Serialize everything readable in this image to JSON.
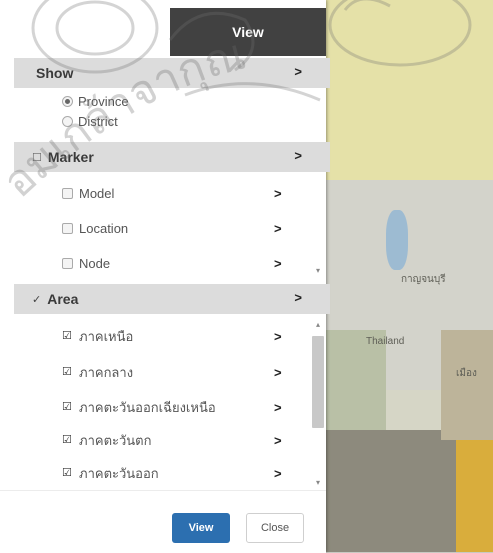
{
  "tabs": {
    "left_label": "",
    "right_label": "View"
  },
  "show": {
    "title": "Show",
    "options": [
      {
        "label": "Province",
        "selected": true
      },
      {
        "label": "District",
        "selected": false
      }
    ]
  },
  "marker": {
    "title": "Marker",
    "items": [
      {
        "label": "Model"
      },
      {
        "label": "Location"
      },
      {
        "label": "Node"
      }
    ]
  },
  "area": {
    "title": "Area",
    "items": [
      {
        "label": "ภาคเหนือ"
      },
      {
        "label": "ภาคกลาง"
      },
      {
        "label": "ภาคตะวันออกเฉียงเหนือ"
      },
      {
        "label": "ภาคตะวันตก"
      },
      {
        "label": "ภาคตะวันออก"
      }
    ]
  },
  "footer": {
    "view_label": "View",
    "close_label": "Close"
  },
  "map": {
    "labels": [
      "กาญจนบุรี",
      "Thailand",
      "เมือง"
    ]
  },
  "watermark": {
    "text": "อมเกล้าจากุณ"
  },
  "colors": {
    "accent": "#2c6fb0",
    "tab_active": "#414141",
    "section_bg": "#dcdcdc"
  }
}
